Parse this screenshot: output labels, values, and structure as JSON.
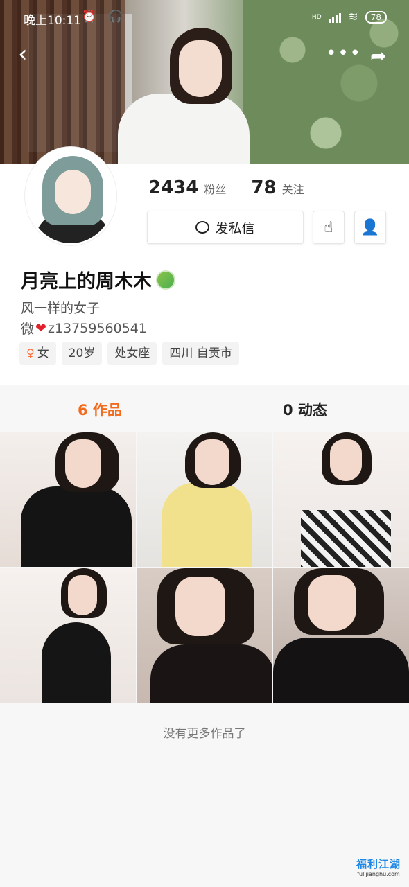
{
  "statusbar": {
    "time": "晚上10:11",
    "icons": "⏰ 🎧",
    "network": "HD",
    "battery": "78"
  },
  "navbar": {
    "back_icon": "‹",
    "more_icon": "•••",
    "share_icon": "➦"
  },
  "profile": {
    "fans_count": "2434",
    "fans_label": "粉丝",
    "following_count": "78",
    "following_label": "关注",
    "message_button": "发私信",
    "name": "月亮上的周木木",
    "bio": "风一样的女子",
    "wechat_prefix": "微",
    "wechat_id": "z13759560541",
    "tags": [
      "女",
      "20岁",
      "处女座",
      "四川 自贡市"
    ]
  },
  "tabs": {
    "works": "6 作品",
    "posts": "0 动态"
  },
  "footer": {
    "no_more": "没有更多作品了"
  },
  "watermark": {
    "logo": "福利江湖",
    "url": "fulijianghu.com"
  },
  "colors": {
    "accent": "#f26b1d",
    "heart": "#e0202a",
    "female": "#ff6d3b"
  }
}
